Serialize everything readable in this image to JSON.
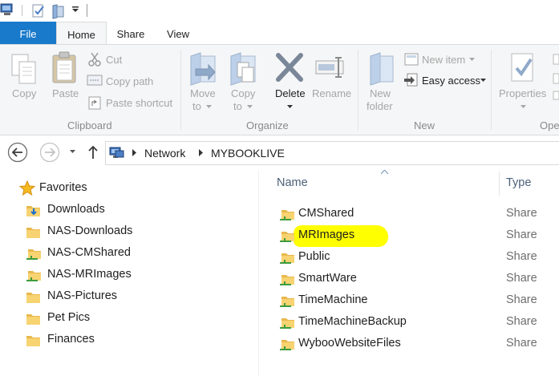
{
  "ribbon_tabs": {
    "file": "File",
    "home": "Home",
    "share": "Share",
    "view": "View"
  },
  "clipboard": {
    "copy": "Copy",
    "paste": "Paste",
    "cut": "Cut",
    "copy_path": "Copy path",
    "paste_shortcut": "Paste shortcut",
    "group_label": "Clipboard"
  },
  "organize": {
    "move_to_line1": "Move",
    "move_to_line2": "to",
    "copy_to_line1": "Copy",
    "copy_to_line2": "to",
    "delete": "Delete",
    "rename": "Rename",
    "group_label": "Organize"
  },
  "new_group": {
    "new_folder_line1": "New",
    "new_folder_line2": "folder",
    "new_item": "New item",
    "easy_access": "Easy access",
    "group_label": "New"
  },
  "open_group": {
    "properties": "Properties",
    "group_label": "Ope"
  },
  "address": {
    "crumbs": [
      "Network",
      "MYBOOKLIVE"
    ]
  },
  "nav": {
    "favorites": "Favorites",
    "items": [
      "Downloads",
      "NAS-Downloads",
      "NAS-CMShared",
      "NAS-MRImages",
      "NAS-Pictures",
      "Pet Pics",
      "Finances"
    ]
  },
  "file_list": {
    "col_name": "Name",
    "col_type": "Type",
    "rows": [
      {
        "name": "CMShared",
        "type": "Share"
      },
      {
        "name": "MRImages",
        "type": "Share"
      },
      {
        "name": "Public",
        "type": "Share"
      },
      {
        "name": "SmartWare",
        "type": "Share"
      },
      {
        "name": "TimeMachine",
        "type": "Share"
      },
      {
        "name": "TimeMachineBackup",
        "type": "Share"
      },
      {
        "name": "WybooWebsiteFiles",
        "type": "Share"
      }
    ],
    "highlighted_row": "MRImages",
    "highlight_color": "#ffff00"
  },
  "colors": {
    "file_tab": "#1979ca",
    "ribbon_bg": "#f5f6f7",
    "header_text": "#4c607a"
  }
}
